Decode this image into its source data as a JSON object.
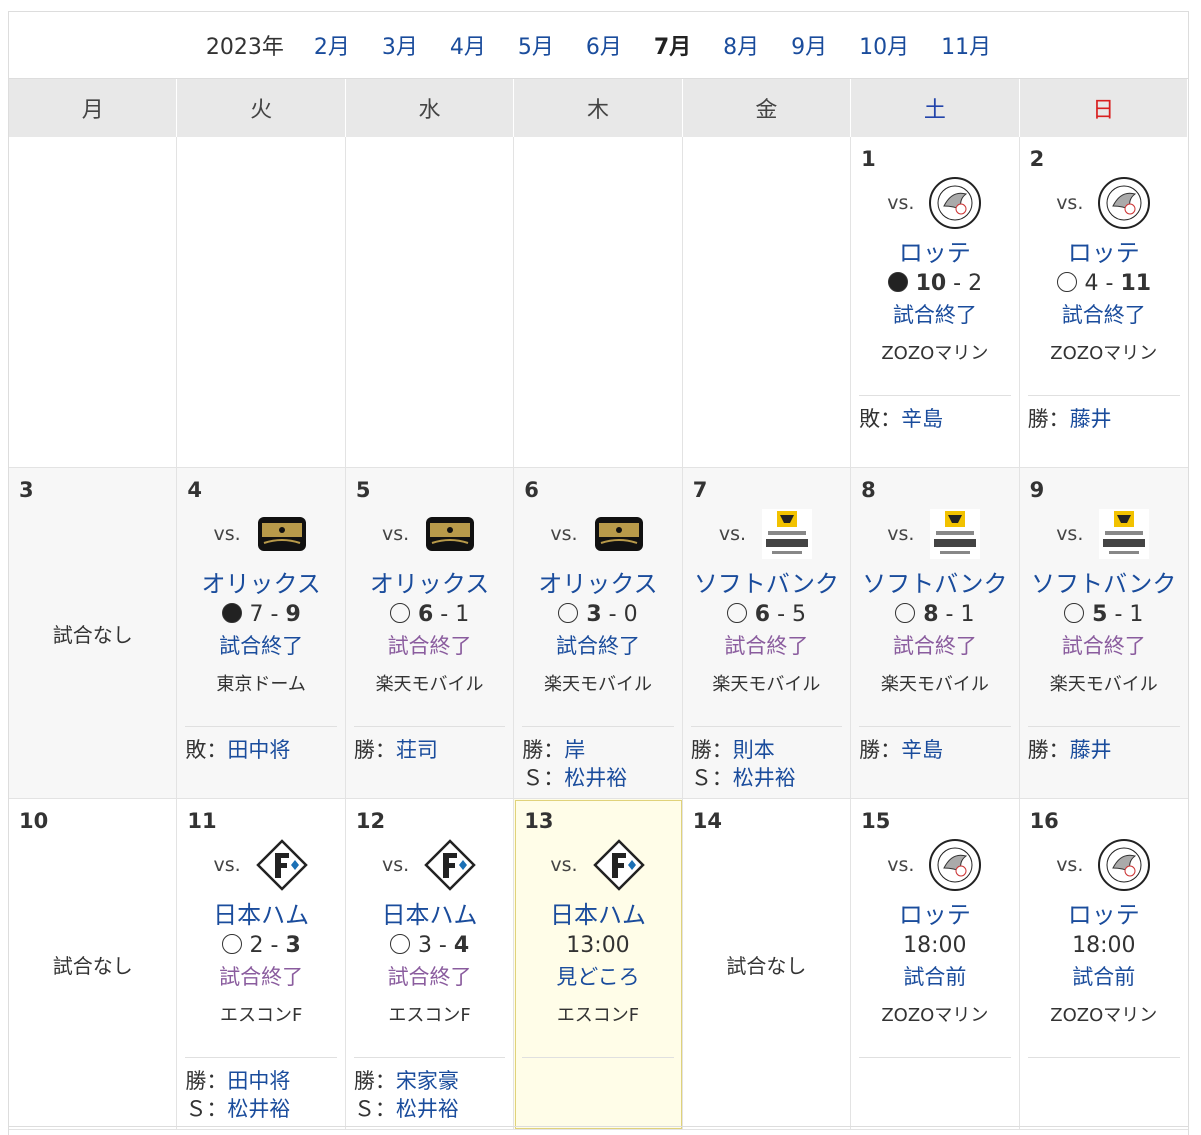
{
  "header": {
    "year": "2023年",
    "months": [
      "2月",
      "3月",
      "4月",
      "5月",
      "6月",
      "7月",
      "8月",
      "9月",
      "10月",
      "11月"
    ],
    "current_month": "7月"
  },
  "weekdays": [
    "月",
    "火",
    "水",
    "木",
    "金",
    "土",
    "日"
  ],
  "labels": {
    "vs": "vs.",
    "no_game": "試合なし",
    "win": "勝：",
    "loss": "敗：",
    "save": "Ｓ："
  },
  "days": [
    {
      "day": ""
    },
    {
      "day": ""
    },
    {
      "day": ""
    },
    {
      "day": ""
    },
    {
      "day": ""
    },
    {
      "day": "1",
      "opp": "ロッテ",
      "logo": "marines-logo",
      "result": "lose",
      "score_l": "10",
      "score_r": "2",
      "bold": "l",
      "status": "試合終了",
      "venue": "ZOZOマリン",
      "p1": {
        "k": "loss",
        "n": "辛島"
      }
    },
    {
      "day": "2",
      "opp": "ロッテ",
      "logo": "marines-logo",
      "result": "win",
      "score_l": "4",
      "score_r": "11",
      "bold": "r",
      "status": "試合終了",
      "venue": "ZOZOマリン",
      "p1": {
        "k": "win",
        "n": "藤井"
      }
    },
    {
      "day": "3",
      "nogame": true
    },
    {
      "day": "4",
      "opp": "オリックス",
      "logo": "buffaloes-logo",
      "result": "lose",
      "score_l": "7",
      "score_r": "9",
      "bold": "r",
      "status": "試合終了",
      "venue": "東京ドーム",
      "p1": {
        "k": "loss",
        "n": "田中将"
      }
    },
    {
      "day": "5",
      "opp": "オリックス",
      "logo": "buffaloes-logo",
      "result": "win",
      "score_l": "6",
      "score_r": "1",
      "bold": "l",
      "status": "試合終了",
      "visited": true,
      "venue": "楽天モバイル",
      "p1": {
        "k": "win",
        "n": "荘司"
      }
    },
    {
      "day": "6",
      "opp": "オリックス",
      "logo": "buffaloes-logo",
      "result": "win",
      "score_l": "3",
      "score_r": "0",
      "bold": "l",
      "status": "試合終了",
      "venue": "楽天モバイル",
      "p1": {
        "k": "win",
        "n": "岸"
      },
      "p2": {
        "k": "save",
        "n": "松井裕"
      }
    },
    {
      "day": "7",
      "opp": "ソフトバンク",
      "logo": "hawks-logo",
      "result": "win",
      "score_l": "6",
      "score_r": "5",
      "bold": "l",
      "status": "試合終了",
      "visited": true,
      "venue": "楽天モバイル",
      "p1": {
        "k": "win",
        "n": "則本"
      },
      "p2": {
        "k": "save",
        "n": "松井裕"
      }
    },
    {
      "day": "8",
      "opp": "ソフトバンク",
      "logo": "hawks-logo",
      "result": "win",
      "score_l": "8",
      "score_r": "1",
      "bold": "l",
      "status": "試合終了",
      "visited": true,
      "venue": "楽天モバイル",
      "p1": {
        "k": "win",
        "n": "辛島"
      }
    },
    {
      "day": "9",
      "opp": "ソフトバンク",
      "logo": "hawks-logo",
      "result": "win",
      "score_l": "5",
      "score_r": "1",
      "bold": "l",
      "status": "試合終了",
      "visited": true,
      "venue": "楽天モバイル",
      "p1": {
        "k": "win",
        "n": "藤井"
      }
    },
    {
      "day": "10",
      "nogame": true
    },
    {
      "day": "11",
      "opp": "日本ハム",
      "logo": "fighters-logo",
      "result": "win",
      "score_l": "2",
      "score_r": "3",
      "bold": "r",
      "status": "試合終了",
      "visited": true,
      "venue": "エスコンF",
      "p1": {
        "k": "win",
        "n": "田中将"
      },
      "p2": {
        "k": "save",
        "n": "松井裕"
      }
    },
    {
      "day": "12",
      "opp": "日本ハム",
      "logo": "fighters-logo",
      "result": "win",
      "score_l": "3",
      "score_r": "4",
      "bold": "r",
      "status": "試合終了",
      "visited": true,
      "venue": "エスコンF",
      "p1": {
        "k": "win",
        "n": "宋家豪"
      },
      "p2": {
        "k": "save",
        "n": "松井裕"
      }
    },
    {
      "day": "13",
      "today": true,
      "opp": "日本ハム",
      "logo": "fighters-logo",
      "time": "13:00",
      "status": "見どころ",
      "venue": "エスコンF"
    },
    {
      "day": "14",
      "nogame": true
    },
    {
      "day": "15",
      "opp": "ロッテ",
      "logo": "marines-logo",
      "time": "18:00",
      "status": "試合前",
      "venue": "ZOZOマリン"
    },
    {
      "day": "16",
      "opp": "ロッテ",
      "logo": "marines-logo",
      "time": "18:00",
      "status": "試合前",
      "venue": "ZOZOマリン"
    }
  ]
}
